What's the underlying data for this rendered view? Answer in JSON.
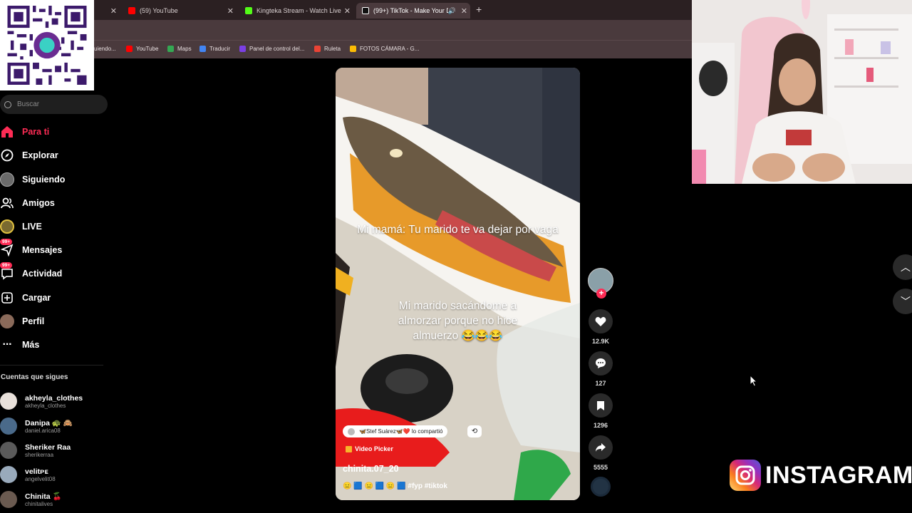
{
  "tabs": [
    {
      "title": "(59) YouTube",
      "fav": "#ff0000"
    },
    {
      "title": "Kingteka Stream - Watch Live o",
      "fav": "#53fc18"
    },
    {
      "title": "(99+) TikTok - Make Your D",
      "fav": "#111111",
      "active": true
    }
  ],
  "bookmarks": [
    {
      "label": "uiendo...",
      "color": "#555555"
    },
    {
      "label": "YouTube",
      "color": "#ff0000"
    },
    {
      "label": "Maps",
      "color": "#34a853"
    },
    {
      "label": "Traducir",
      "color": "#4285f4"
    },
    {
      "label": "Panel de control del...",
      "color": "#7b3fe4"
    },
    {
      "label": "Ruleta",
      "color": "#ea4335"
    },
    {
      "label": "FOTOS CÁMARA - G...",
      "color": "#fbbc04"
    }
  ],
  "qr_brand": "yape",
  "search": {
    "placeholder": "Buscar"
  },
  "nav": [
    {
      "label": "Para ti",
      "icon": "home-icon",
      "active": true
    },
    {
      "label": "Explorar",
      "icon": "compass-icon"
    },
    {
      "label": "Siguiendo",
      "icon": "following-avatar-icon"
    },
    {
      "label": "Amigos",
      "icon": "friends-icon"
    },
    {
      "label": "LIVE",
      "icon": "live-icon"
    },
    {
      "label": "Mensajes",
      "icon": "messages-icon",
      "badge": "99+"
    },
    {
      "label": "Actividad",
      "icon": "activity-icon",
      "badge": "99+"
    },
    {
      "label": "Cargar",
      "icon": "upload-icon"
    },
    {
      "label": "Perfil",
      "icon": "profile-avatar-icon"
    },
    {
      "label": "Más",
      "icon": "more-icon"
    }
  ],
  "following_header": "Cuentas que sigues",
  "accounts": [
    {
      "name": "akheyla_clothes",
      "user": "akheyla_clothes",
      "color": "#e8e0da"
    },
    {
      "name": "Danipa 🐢 🙈",
      "user": "daniel.arica08",
      "color": "#4a6a8a"
    },
    {
      "name": "Sheriker Raa",
      "user": "sherikerraa",
      "color": "#5a5a5a"
    },
    {
      "name": "velitᴘᴇ",
      "user": "angelvelit08",
      "color": "#9ab"
    },
    {
      "name": "Chinita 🍒",
      "user": "chinitalives",
      "color": "#6a5a50"
    }
  ],
  "video": {
    "caption_top": "Mi mamá: Tu marido te va dejar por vaga",
    "caption_bottom": "Mi marido sacándome a almorzar porque no hice almuerzo 😂😂😂",
    "shared_text": "🦋Stef Suárez🦋❤️ lo compartió",
    "video_picker": "Video Picker",
    "author": "chinita.07_20",
    "description": "😑 🟦 😑 🟦 😑 🟦 #fyp #tiktok"
  },
  "actions": {
    "likes": "12.9K",
    "comments": "127",
    "saves": "1296",
    "shares": "5555"
  },
  "instagram_label": "INSTAGRAM"
}
